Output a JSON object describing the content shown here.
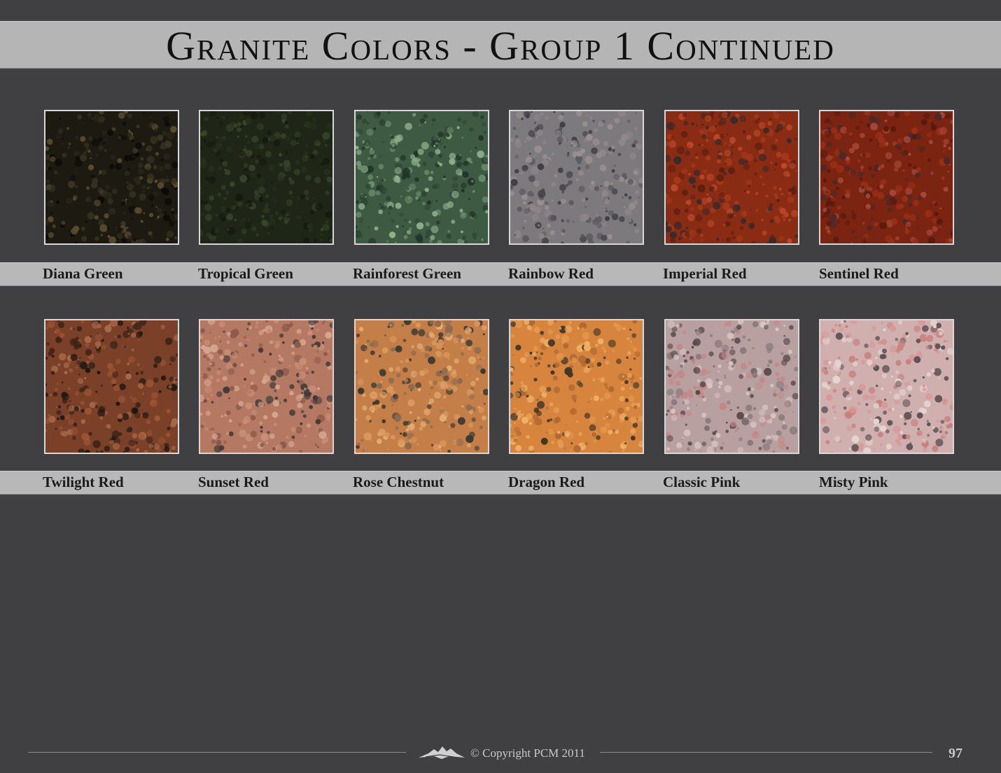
{
  "header": {
    "title": "Granite Colors - Group 1 Continued"
  },
  "rows": [
    {
      "swatches": [
        {
          "name": "Diana Green",
          "base": "#1d1a12",
          "specks": [
            "#3a3524",
            "#0c0b08",
            "#5a4d2e",
            "#2a281c"
          ]
        },
        {
          "name": "Tropical Green",
          "base": "#1f2617",
          "specks": [
            "#2e3a22",
            "#151a10",
            "#38452a",
            "#23301b"
          ]
        },
        {
          "name": "Rainforest Green",
          "base": "#3e5a42",
          "specks": [
            "#6a8d6b",
            "#22332a",
            "#8fb08c",
            "#2e4735"
          ]
        },
        {
          "name": "Rainbow Red",
          "base": "#7d7a7d",
          "specks": [
            "#8e8589",
            "#5d5a60",
            "#9b8f8f",
            "#3f3c42"
          ]
        },
        {
          "name": "Imperial Red",
          "base": "#8a2c14",
          "specks": [
            "#a6391a",
            "#5e2010",
            "#3a2a2a",
            "#b9482a"
          ]
        },
        {
          "name": "Sentinel Red",
          "base": "#7c2412",
          "specks": [
            "#9a3016",
            "#5a1a0c",
            "#a6483a",
            "#4a2a28"
          ]
        }
      ]
    },
    {
      "swatches": [
        {
          "name": "Twilight Red",
          "base": "#7a4028",
          "specks": [
            "#9a5232",
            "#3c2418",
            "#1e1814",
            "#a86a4a"
          ]
        },
        {
          "name": "Sunset Red",
          "base": "#b57862",
          "specks": [
            "#c98d74",
            "#3e3a3a",
            "#8a5a4a",
            "#d6a690"
          ]
        },
        {
          "name": "Rose Chestnut",
          "base": "#c47e48",
          "specks": [
            "#d9955a",
            "#3a3a32",
            "#8a6a50",
            "#e6ad72"
          ]
        },
        {
          "name": "Dragon Red",
          "base": "#d6843e",
          "specks": [
            "#e69a4e",
            "#3e3628",
            "#b06a32",
            "#f0b066"
          ]
        },
        {
          "name": "Classic Pink",
          "base": "#b8a0a0",
          "specks": [
            "#d8c4c4",
            "#5a4a4c",
            "#c48886",
            "#8a7a7c"
          ]
        },
        {
          "name": "Misty Pink",
          "base": "#cfb0ae",
          "specks": [
            "#e6d4d2",
            "#c8807c",
            "#5e5256",
            "#d89896"
          ]
        }
      ]
    }
  ],
  "footer": {
    "copyright": "© Copyright PCM 2011",
    "page_number": "97"
  }
}
